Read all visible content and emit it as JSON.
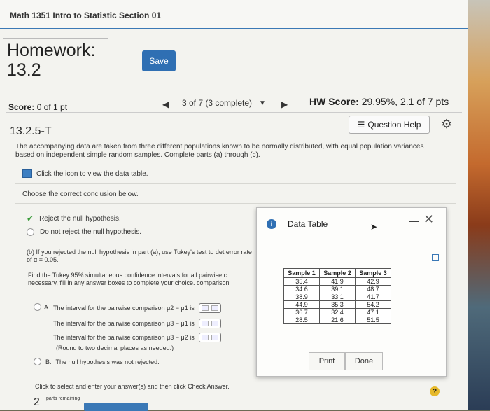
{
  "course": {
    "title": "Math 1351 Intro to Statistic Section 01"
  },
  "homework": {
    "title_line1": "Homework:",
    "title_line2": "13.2",
    "save_label": "Save"
  },
  "score": {
    "label": "Score:",
    "value": "0 of 1 pt"
  },
  "navigation": {
    "status": "3 of 7 (3 complete)"
  },
  "hw_score": {
    "label": "HW Score:",
    "value": "29.95%, 2.1 of 7 pts"
  },
  "question": {
    "id": "13.2.5-T",
    "help_label": "Question Help",
    "prompt": "The accompanying data are taken from three different populations known to be normally distributed, with equal population variances based on independent simple random samples. Complete parts (a) through (c).",
    "data_link": "Click the icon to view the data table.",
    "choose": "Choose the correct conclusion below.",
    "option_reject": "Reject the null hypothesis.",
    "option_not_reject": "Do not reject the null hypothesis.",
    "part_b": "(b) If you rejected the null hypothesis in part (a), use Tukey's test to det error rate of α = 0.05.",
    "find_text": "Find the Tukey 95% simultaneous confidence intervals for all pairwise c necessary, fill in any answer boxes to complete your choice. comparison",
    "option_a_letter": "A.",
    "option_a_line1": "The interval for the pairwise comparison μ2 − μ1 is",
    "option_a_line2": "The interval for the pairwise comparison μ3 − μ1 is",
    "option_a_line3": "The interval for the pairwise comparison μ3 − μ2 is",
    "round_note": "(Round to two decimal places as needed.)",
    "option_b_letter": "B.",
    "option_b_text": "The null hypothesis was not rejected.",
    "click_note": "Click to select and enter your answer(s) and then click Check Answer.",
    "parts_count": "2",
    "parts_label": "parts remaining"
  },
  "data_table": {
    "title": "Data Table",
    "headers": [
      "Sample 1",
      "Sample 2",
      "Sample 3"
    ],
    "rows": [
      [
        "35.4",
        "41.9",
        "42.9"
      ],
      [
        "34.6",
        "39.1",
        "48.7"
      ],
      [
        "38.9",
        "33.1",
        "41.7"
      ],
      [
        "44.9",
        "35.3",
        "54.2"
      ],
      [
        "36.7",
        "32.4",
        "47.1"
      ],
      [
        "28.5",
        "21.6",
        "51.5"
      ]
    ],
    "print_label": "Print",
    "done_label": "Done"
  },
  "colors": {
    "accent": "#2f6fb3",
    "help": "#e6b92a"
  }
}
